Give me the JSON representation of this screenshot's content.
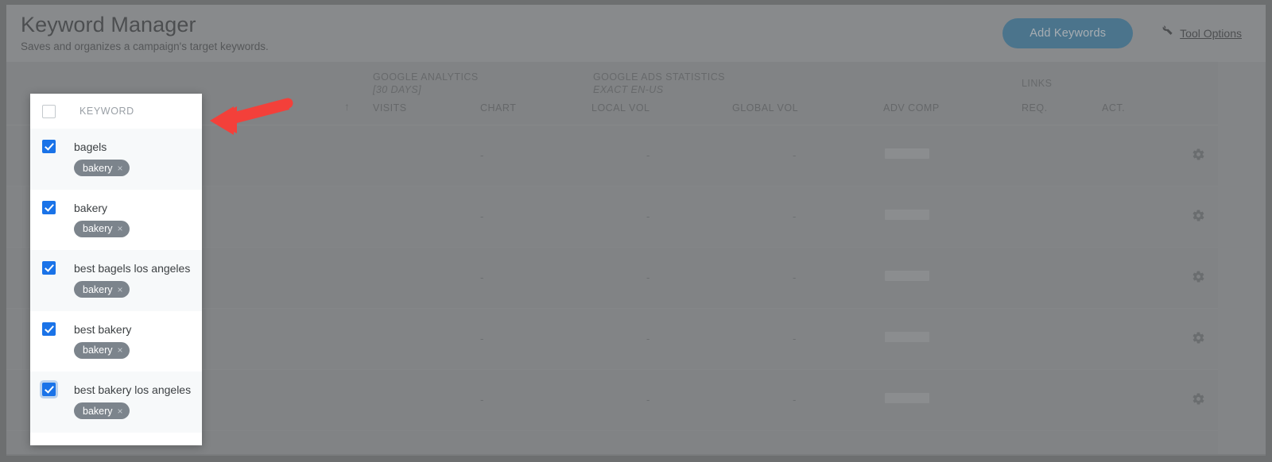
{
  "header": {
    "title": "Keyword Manager",
    "subtitle": "Saves and organizes a campaign's target keywords.",
    "add_keywords_label": "Add Keywords",
    "tool_options_label": "Tool Options",
    "tool_options_icon": "wrench-icon",
    "accent_color": "#1a6d9e"
  },
  "table": {
    "group_headers": [
      {
        "label": "GOOGLE ANALYTICS",
        "sub": "[30 DAYS]"
      },
      {
        "label": "GOOGLE ADS STATISTICS",
        "sub": "EXACT EN-US"
      },
      {
        "label": "LINKS",
        "sub": ""
      }
    ],
    "sort_indicator": "↑",
    "columns": [
      "VISITS",
      "CHART",
      "LOCAL VOL",
      "GLOBAL VOL",
      "ADV COMP",
      "REQ.",
      "ACT."
    ],
    "row_settings_icon": "gear-icon",
    "rows": [
      {
        "visits": "",
        "chart": "-",
        "local_vol": "-",
        "global_vol": "-",
        "adv_comp": "",
        "req": "",
        "act": ""
      },
      {
        "visits": "",
        "chart": "-",
        "local_vol": "-",
        "global_vol": "-",
        "adv_comp": "",
        "req": "",
        "act": ""
      },
      {
        "visits": "",
        "chart": "-",
        "local_vol": "-",
        "global_vol": "-",
        "adv_comp": "",
        "req": "",
        "act": ""
      },
      {
        "visits": "",
        "chart": "-",
        "local_vol": "-",
        "global_vol": "-",
        "adv_comp": "",
        "req": "",
        "act": ""
      },
      {
        "visits": "",
        "chart": "-",
        "local_vol": "-",
        "global_vol": "-",
        "adv_comp": "",
        "req": "",
        "act": ""
      }
    ]
  },
  "keyword_panel": {
    "header_label": "KEYWORD",
    "select_all_checked": false,
    "tag_remove_icon": "close-icon",
    "checked_color": "#1a73e8",
    "items": [
      {
        "keyword": "bagels",
        "tag": "bakery",
        "checked": true,
        "focused": false
      },
      {
        "keyword": "bakery",
        "tag": "bakery",
        "checked": true,
        "focused": false
      },
      {
        "keyword": "best bagels los angeles",
        "tag": "bakery",
        "checked": true,
        "focused": false
      },
      {
        "keyword": "best bakery",
        "tag": "bakery",
        "checked": true,
        "focused": false
      },
      {
        "keyword": "best bakery los angeles",
        "tag": "bakery",
        "checked": true,
        "focused": true
      }
    ]
  },
  "annotation": {
    "arrow_icon": "red-arrow-left-icon",
    "color": "#f3403a"
  }
}
